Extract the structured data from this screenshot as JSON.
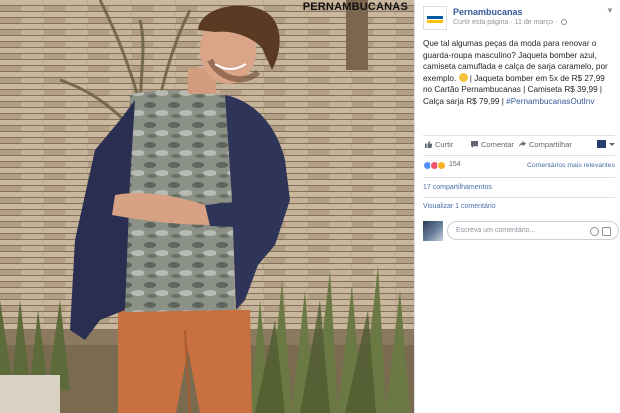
{
  "photo": {
    "brand_overlay": "PERNAMBUCANAS"
  },
  "post": {
    "page_name": "Pernambucanas",
    "meta_action": "Curtir esta página",
    "date": "11 de março",
    "text_line1": "Que tal algumas peças da moda para renovar o guarda-roupa masculino? Jaqueta bomber azul, camiseta camuflada e calça de sarja caramelo, por exemplo.",
    "text_line2": " | Jaqueta bomber em 5x de R$ 27,99 no Cartão Pernambucanas | Camiseta R$ 39,99 | Calça sarja R$ 79,99 |",
    "hashtag": "#PernambucanasOutInv"
  },
  "actions": {
    "like": "Curtir",
    "comment": "Comentar",
    "share": "Compartilhar"
  },
  "reactions": {
    "count": "154",
    "sort_label": "Comentários mais relevantes"
  },
  "shares": "17 compartilhamentos",
  "view_comments": "Visualizar 1 comentário",
  "comment_input": {
    "placeholder": "Escreva um comentário..."
  },
  "colors": {
    "link": "#365899",
    "brand_blue": "#00599c",
    "brand_yellow": "#fcc200"
  }
}
